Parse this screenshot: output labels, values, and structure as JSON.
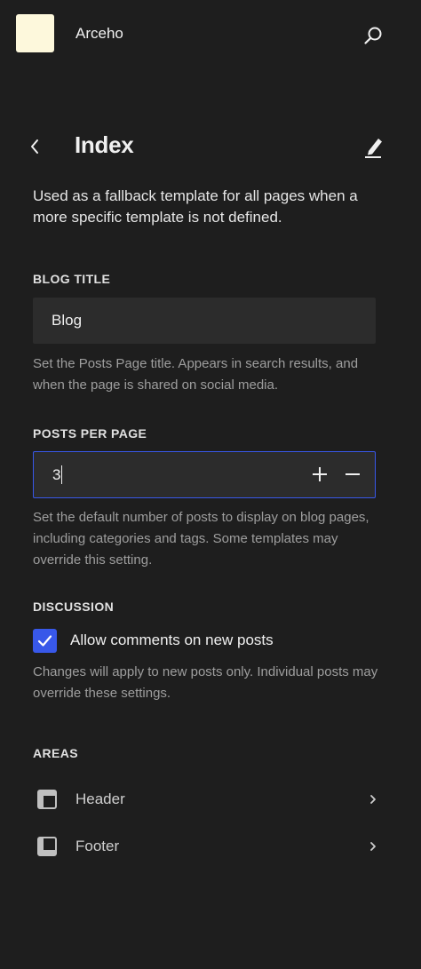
{
  "site": {
    "name": "Arceho",
    "logo_color": "#fdf8dc"
  },
  "icons": {
    "search": "search-icon",
    "back": "chevron-left-icon",
    "edit": "pencil-icon",
    "plus": "plus-icon",
    "minus": "minus-icon",
    "check": "checkmark-icon",
    "layout": "layout-icon",
    "chevron": "chevron-right-icon"
  },
  "template": {
    "title": "Index",
    "description": "Used as a fallback template for all pages when a more specific template is not defined."
  },
  "blog_title": {
    "label": "BLOG TITLE",
    "value": "Blog",
    "help": "Set the Posts Page title. Appears in search results, and when the page is shared on social media."
  },
  "posts_per_page": {
    "label": "POSTS PER PAGE",
    "value": "3",
    "help": "Set the default number of posts to display on blog pages, including categories and tags. Some templates may override this setting."
  },
  "discussion": {
    "label": "DISCUSSION",
    "checkbox_label": "Allow comments on new posts",
    "checked": true,
    "help": "Changes will apply to new posts only. Individual posts may override these settings."
  },
  "areas": {
    "label": "AREAS",
    "items": [
      {
        "label": "Header"
      },
      {
        "label": "Footer"
      }
    ]
  },
  "colors": {
    "background": "#1e1e1e",
    "accent": "#3858e9",
    "input_bg": "#2c2c2c",
    "help_text": "#9e9e9e"
  }
}
